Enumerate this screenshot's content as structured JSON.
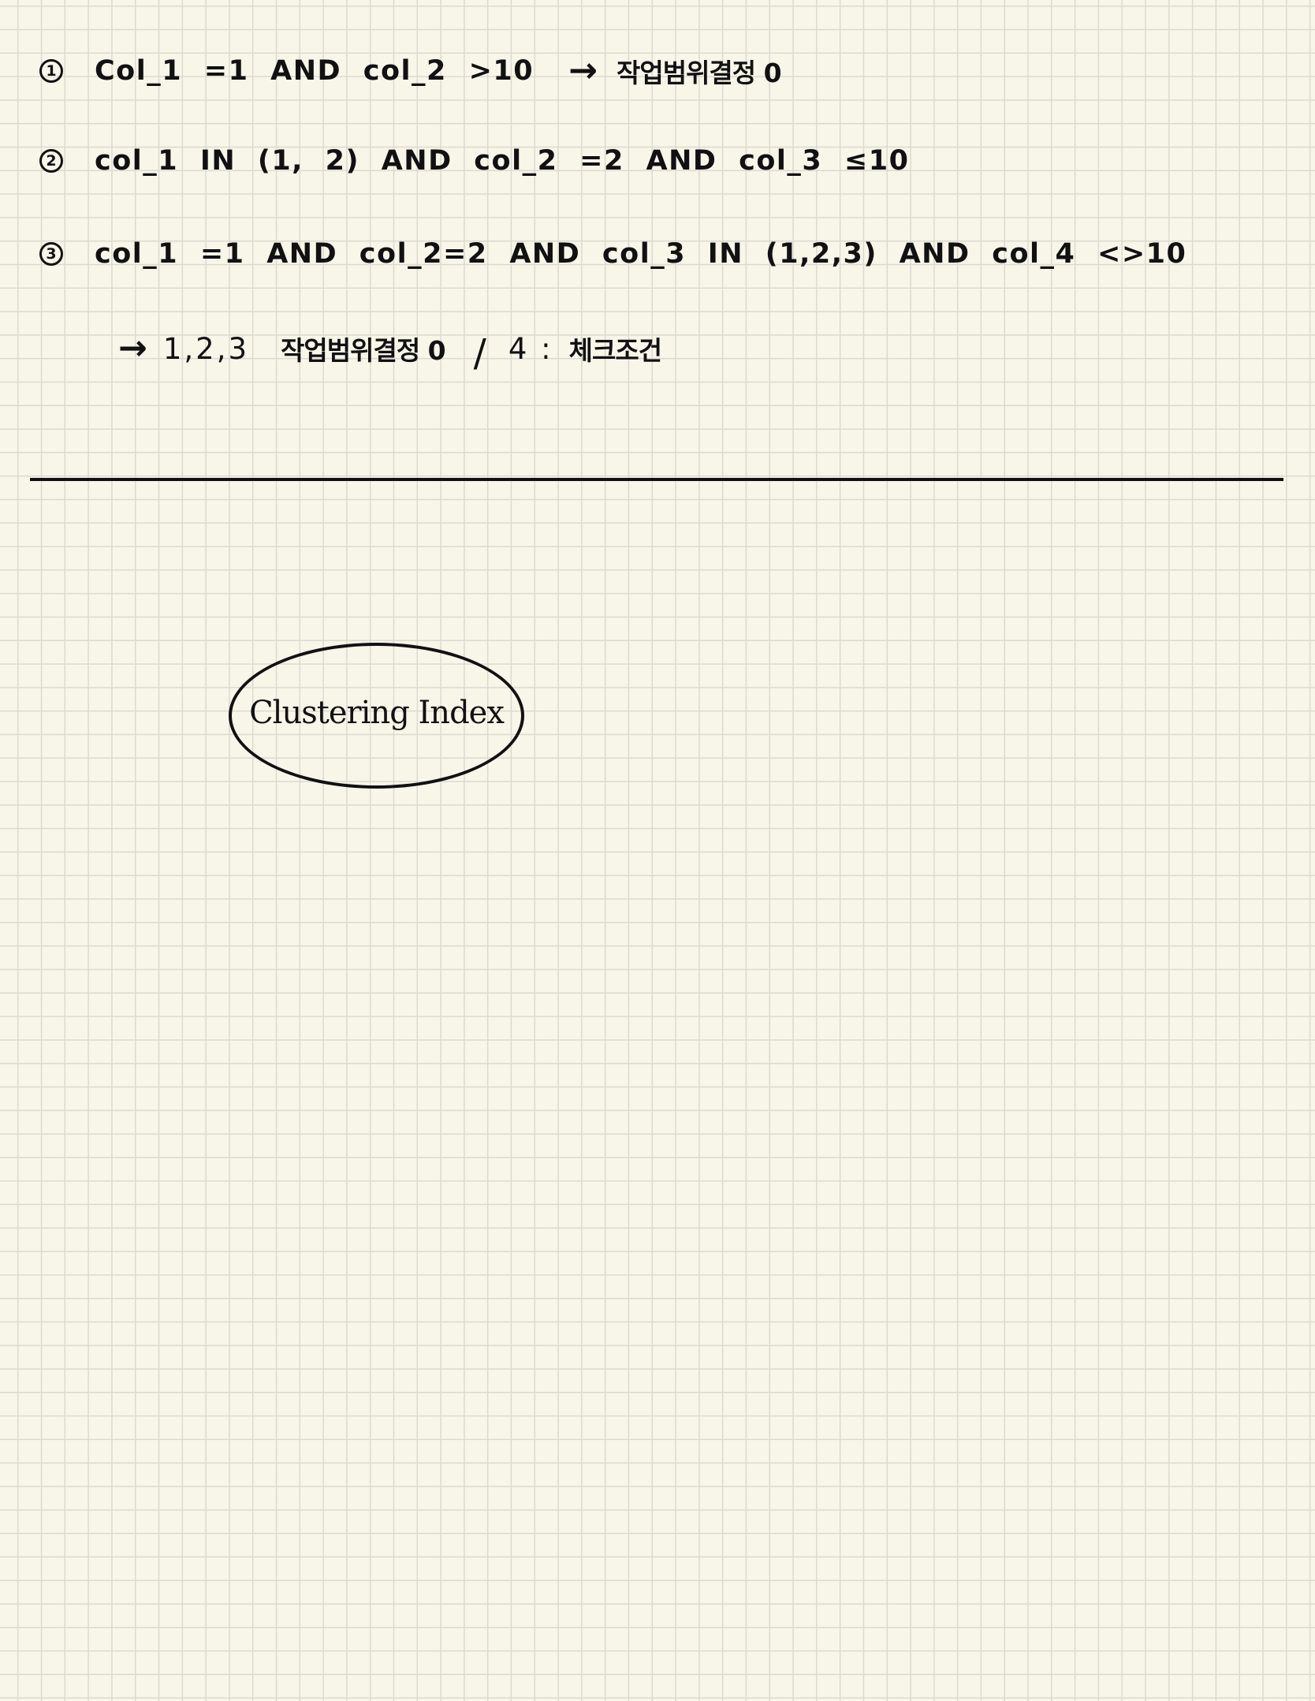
{
  "notes": [
    {
      "marker": "1",
      "expr": "Col_1 =1  AND  col_2 >10",
      "arrow": "→",
      "result": "작업범위결정 0"
    },
    {
      "marker": "2",
      "expr": "col_1  IN (1, 2)  AND  col_2 =2  AND  col_3 ≤10"
    },
    {
      "marker": "3",
      "expr": "col_1 =1  AND  col_2=2  AND  col_3 IN (1,2,3)  AND  col_4 <>10"
    }
  ],
  "followup": {
    "arrow": "→",
    "items": "1,2,3",
    "result": "작업범위결정 0",
    "slash": "/",
    "item4": "4 :",
    "label4": "체크조건"
  },
  "oval_label": "Clustering Index"
}
